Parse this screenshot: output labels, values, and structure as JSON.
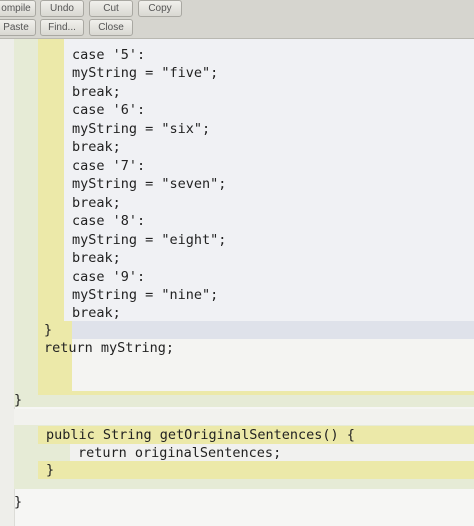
{
  "toolbar": {
    "row1": [
      "ompile",
      "Undo",
      "Cut",
      "Copy"
    ],
    "row2": [
      "Paste",
      "Find...",
      "Close"
    ]
  },
  "code": {
    "lines": [
      "case '5':",
      "myString = \"five\";",
      "break;",
      "case '6':",
      "myString = \"six\";",
      "break;",
      "case '7':",
      "myString = \"seven\";",
      "break;",
      "case '8':",
      "myString = \"eight\";",
      "break;",
      "case '9':",
      "myString = \"nine\";",
      "break;",
      "}",
      "return myString;",
      "}",
      "public String getOriginalSentences() {",
      "return originalSentences;",
      "}",
      "}"
    ]
  },
  "colors": {
    "toolbar_bg": "#d6d5cf",
    "editor_bg": "#f6f6f4",
    "block_yellow": "#ede9a7",
    "block_green": "#e4ecd4",
    "block_blue": "#eef0f4"
  }
}
